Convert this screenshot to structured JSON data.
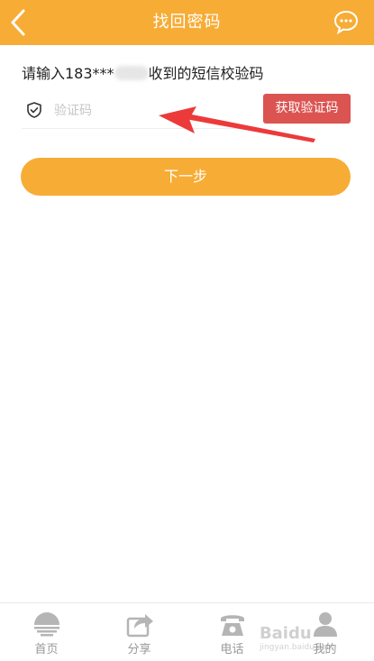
{
  "header": {
    "title": "找回密码",
    "color": "#f7ac35"
  },
  "prompt": {
    "prefix": "请输入183***",
    "suffix": "收到的短信校验码"
  },
  "code_input": {
    "placeholder": "验证码",
    "value": ""
  },
  "get_code_button": {
    "label": "获取验证码",
    "color": "#dc5451"
  },
  "next_button": {
    "label": "下一步"
  },
  "tabbar": {
    "items": [
      {
        "label": "首页",
        "icon": "home-icon"
      },
      {
        "label": "分享",
        "icon": "share-icon"
      },
      {
        "label": "电话",
        "icon": "phone-icon"
      },
      {
        "label": "我的",
        "icon": "user-icon"
      }
    ]
  },
  "watermark": {
    "text": "Baidu",
    "sub": "jingyan.baidu.com"
  }
}
